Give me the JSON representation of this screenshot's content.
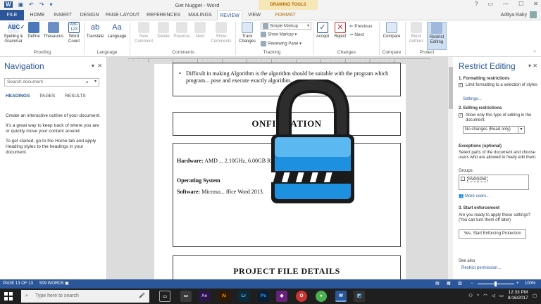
{
  "title_bar": {
    "window_title": "Get Nugget - Word",
    "context_title": "DRAWING TOOLS",
    "qat_icons": [
      "word-logo-icon",
      "save-icon",
      "undo-icon",
      "redo-icon",
      "customize-qat-icon"
    ],
    "window_controls": [
      "help-icon",
      "ribbon-display-icon",
      "minimize-icon",
      "maximize-icon",
      "close-icon"
    ]
  },
  "tabs": [
    "FILE",
    "HOME",
    "INSERT",
    "DESIGN",
    "PAGE LAYOUT",
    "REFERENCES",
    "MAILINGS",
    "REVIEW",
    "VIEW",
    "FORMAT"
  ],
  "user": {
    "name": "Aditya Raky"
  },
  "ribbon": {
    "spelling": "Spelling &\nGrammar",
    "define": "Define",
    "thesaurus": "Thesaurus",
    "word_count": "Word\nCount",
    "proofing_label": "Proofing",
    "translate": "Translate",
    "language": "Language",
    "language_label": "Language",
    "new_comment": "New\nComment",
    "delete": "Delete",
    "previous": "Previous",
    "next": "Next",
    "show_comments": "Show\nComments",
    "comments_label": "Comments",
    "track_changes": "Track\nChanges",
    "simple_markup": "Simple Markup",
    "show_markup": "Show Markup",
    "reviewing_pane": "Reviewing Pane",
    "tracking_label": "Tracking",
    "accept": "Accept",
    "reject": "Reject",
    "prev_change": "Previous",
    "next_change": "Next",
    "changes_label": "Changes",
    "compare": "Compare",
    "compare_label": "Compare",
    "block_authors": "Block\nAuthors",
    "restrict_editing": "Restrict\nEditing",
    "protect_label": "Protect"
  },
  "nav": {
    "title": "Navigation",
    "search_placeholder": "Search document",
    "tab_headings": "HEADINGS",
    "tab_pages": "PAGES",
    "tab_results": "RESULTS",
    "p1": "Create an interactive outline of your document.",
    "p2": "It's a great way to keep track of where you are or quickly move your content around.",
    "p3": "To get started, go to the Home tab and apply Heading styles to the headings in your document."
  },
  "doc": {
    "bullet": "Difficult in making Algorithm is the algorithm should be suitable with the program which program... pose and execute exactly algorithm.",
    "heading_config": "ONFIGUATION",
    "hardware_label": "Hardware:",
    "hardware_text": "AMD ... 2.10GHz, 6.00GB RAM, 500GB HDD.",
    "os_label": "Operating System",
    "software_label": "Software:",
    "software_text": "Microso... ffice Word 2013.",
    "heading_project": "PROJECT FILE DETAILS"
  },
  "restrict": {
    "title": "Restrict Editing",
    "s1": "1. Formatting restrictions",
    "s1_opt": "Limit formatting to a selection of styles",
    "settings": "Settings...",
    "s2": "2. Editing restrictions",
    "s2_opt": "Allow only this type of editing in the document:",
    "s2_select": "No changes (Read only)",
    "exceptions": "Exceptions (optional)",
    "exceptions_text": "Select parts of the document and choose users who are allowed to freely edit them.",
    "groups": "Groups:",
    "everyone": "Everyone",
    "more_users": "More users...",
    "s3": "3. Start enforcement",
    "s3_text": "Are you ready to apply these settings? (You can turn them off later)",
    "enforce_button": "Yes, Start Enforcing Protection",
    "see_also": "See also",
    "restrict_permission": "Restrict permission..."
  },
  "status": {
    "page": "PAGE 13 OF 13",
    "words": "509 WORDS",
    "zoom": "100%"
  },
  "taskbar": {
    "search_placeholder": "Type here to search",
    "time": "12:33 PM",
    "date": "8/16/2017"
  },
  "colors": {
    "word_blue": "#2b579a",
    "lock_blue": "#1e90e0",
    "format_tab": "#b36b00"
  }
}
